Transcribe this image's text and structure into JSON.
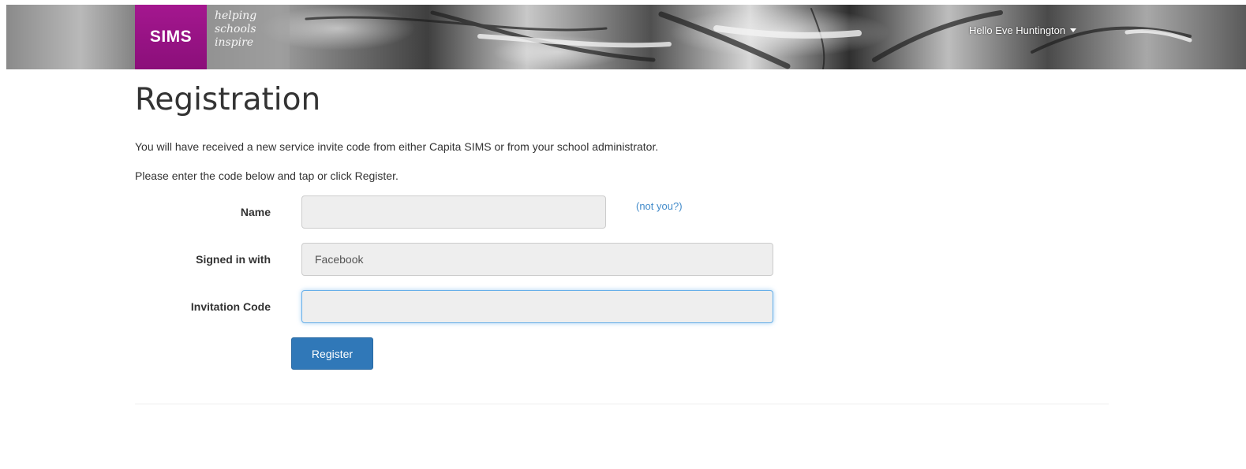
{
  "header": {
    "logo_text": "SIMS",
    "tagline": [
      "helping",
      "schools",
      "inspire"
    ],
    "user_greeting": "Hello Eve Huntington"
  },
  "page": {
    "title": "Registration",
    "intro_line_1": "You will have received a new service invite code from either Capita SIMS or from your school administrator.",
    "intro_line_2": "Please enter the code below and tap or click Register."
  },
  "form": {
    "name": {
      "label": "Name",
      "value": "",
      "not_you_link": "(not you?)"
    },
    "signed_in_with": {
      "label": "Signed in with",
      "value": "Facebook"
    },
    "invitation_code": {
      "label": "Invitation Code",
      "value": ""
    },
    "register_label": "Register"
  },
  "colors": {
    "brand_purple": "#9b1287",
    "primary_button": "#3078b8",
    "link": "#428bca",
    "focus_border": "#66afe9"
  },
  "icons": {
    "user_menu": "caret-down-icon"
  }
}
